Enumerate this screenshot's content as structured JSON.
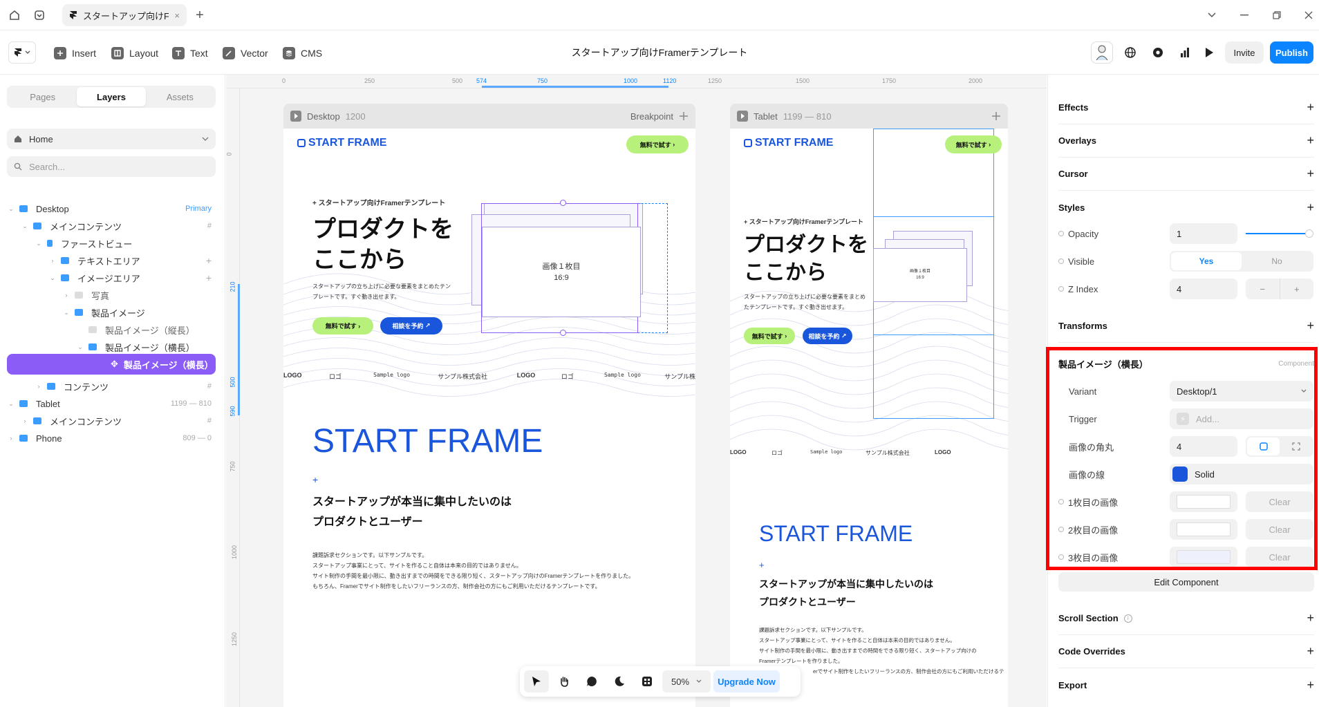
{
  "titlebar": {
    "tab_title": "スタートアップ向けFramerテンプレート",
    "tab_title_short": "スタートアップ向けFr...",
    "close": "×",
    "newtab": "+"
  },
  "toolbar": {
    "insert": "Insert",
    "layout": "Layout",
    "text": "Text",
    "vector": "Vector",
    "cms": "CMS",
    "doc_title": "スタートアップ向けFramerテンプレート",
    "invite": "Invite",
    "publish": "Publish"
  },
  "left": {
    "tabs": [
      "Pages",
      "Layers",
      "Assets"
    ],
    "page": "Home",
    "search_placeholder": "Search...",
    "layers": [
      {
        "name": "Desktop",
        "right": "Primary"
      },
      {
        "name": "メインコンテンツ",
        "right": "#"
      },
      {
        "name": "ファーストビュー",
        "right": ""
      },
      {
        "name": "テキストエリア",
        "right": "+"
      },
      {
        "name": "イメージエリア",
        "right": "+"
      },
      {
        "name": "写真",
        "right": ""
      },
      {
        "name": "製品イメージ",
        "right": ""
      },
      {
        "name": "製品イメージ（縦長）",
        "right": ""
      },
      {
        "name": "製品イメージ（横長）",
        "right": ""
      },
      {
        "name": "製品イメージ（横長）",
        "right": ""
      },
      {
        "name": "コンテンツ",
        "right": "#"
      },
      {
        "name": "Tablet",
        "right": "1199 — 810"
      },
      {
        "name": "メインコンテンツ",
        "right": "#"
      },
      {
        "name": "Phone",
        "right": "809 — 0"
      }
    ]
  },
  "canvas": {
    "ruler_top": [
      "0",
      "250",
      "500",
      "574",
      "750",
      "1000",
      "1120",
      "1250",
      "1500",
      "1750",
      "2000"
    ],
    "ruler_left": [
      "0",
      "210",
      "500",
      "590",
      "750",
      "1000",
      "1250",
      "1500"
    ],
    "desktop": {
      "label": "Desktop",
      "size": "1200",
      "breakpoint": "Breakpoint"
    },
    "tablet": {
      "label": "Tablet",
      "size": "1199 — 810"
    },
    "site": {
      "logo": "START FRAME",
      "cta_green": "無料で試す",
      "cta_blue": "相談を予約",
      "eyebrow": "スタートアップ向けFramerテンプレート",
      "hero_line1": "プロダクトを",
      "hero_line2": "ここから",
      "hero_desc1": "スタートアップの立ち上げに必要な要素をまとめたテン",
      "hero_desc2": "プレートです。すぐ動き出せます。",
      "tablet_desc1": "スタートアップの立ち上げに必要な要素をまとめ",
      "tablet_desc2": "たテンプレートです。すぐ動き出せます。",
      "image_label": "画像１枚目",
      "image_ratio": "16:9",
      "logos": [
        "LOGO",
        "ロゴ",
        "Sample logo",
        "サンプル株式会社",
        "LOGO",
        "ロゴ",
        "Sample logo",
        "サンプル株"
      ],
      "tablet_logos": [
        "LOGO",
        "ロゴ",
        "Sample logo",
        "サンプル株式会社",
        "LOGO"
      ],
      "big_title": "START FRAME",
      "sub1": "スタートアップが本当に集中したいのは",
      "sub2": "プロダクトとユーザー",
      "body": [
        "課題訴求セクションです。以下サンプルです。",
        "スタートアップ事業にとって、サイトを作ること自体は本来の目的ではありません。",
        "サイト制作の手間を最小限に、動き出すまでの時間をできる限り短く、スタートアップ向けのFramerテンプレートを作りました。",
        "もちろん、Framerでサイト制作をしたいフリーランスの方、制作会社の方にもご利用いただけるテンプレートです。"
      ],
      "tablet_body": [
        "課題訴求セクションです。以下サンプルです。",
        "スタートアップ事業にとって、サイトを作ること自体は本来の目的ではありません。",
        "サイト制作の手間を最小限に、動き出すまでの時間をできる限り短く、スタートアップ向けの",
        "Framerテンプレートを作りました。",
        "erでサイト制作をしたいフリーランスの方、制作会社の方にもご利用いただけるテ"
      ]
    },
    "zoom": "50%",
    "upgrade": "Upgrade Now"
  },
  "right": {
    "effects": "Effects",
    "overlays": "Overlays",
    "cursor": "Cursor",
    "styles": "Styles",
    "opacity_label": "Opacity",
    "opacity_value": "1",
    "visible_label": "Visible",
    "visible_yes": "Yes",
    "visible_no": "No",
    "zindex_label": "Z Index",
    "zindex_value": "4",
    "zindex_minus": "−",
    "zindex_plus": "+",
    "transforms": "Transforms",
    "component_title": "製品イメージ（横長）",
    "component_tag": "Component",
    "variant_label": "Variant",
    "variant_value": "Desktop/1",
    "trigger_label": "Trigger",
    "trigger_placeholder": "Add...",
    "radius_label": "画像の角丸",
    "radius_value": "4",
    "stroke_label": "画像の線",
    "stroke_value": "Solid",
    "stroke_color": "#1a56db",
    "img1_label": "1枚目の画像",
    "img2_label": "2枚目の画像",
    "img3_label": "3枚目の画像",
    "clear": "Clear",
    "edit_component": "Edit Component",
    "scroll_section": "Scroll Section",
    "code_overrides": "Code Overrides",
    "export": "Export"
  },
  "colors": {
    "accent": "#0a84ff",
    "selection": "#8b5cf6",
    "brand": "#1a56db",
    "cta": "#b7f07a",
    "highlight": "#ff0000"
  }
}
